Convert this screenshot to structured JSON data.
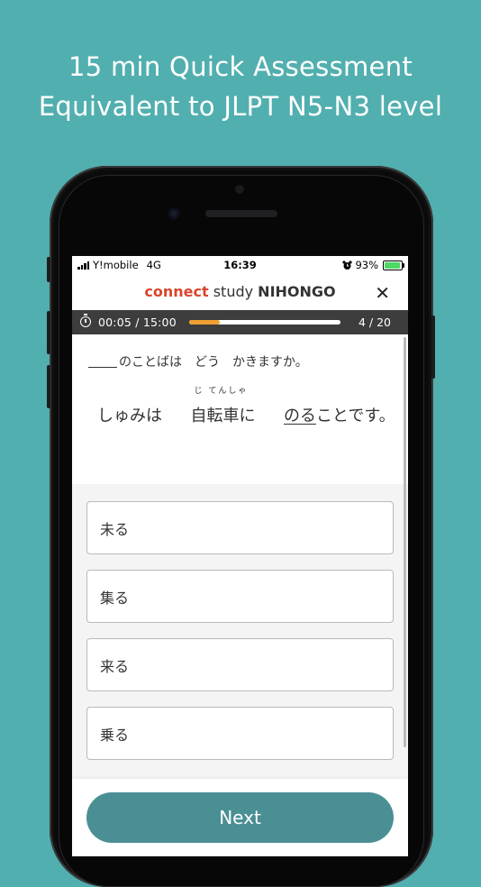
{
  "headline": {
    "line1": "15 min Quick Assessment",
    "line2": "Equivalent to JLPT N5-N3 level"
  },
  "status_bar": {
    "carrier": "Y!mobile",
    "network": "4G",
    "time": "16:39",
    "alarm_icon": "alarm-clock-icon",
    "battery_percent_text": "93%",
    "battery_level": 0.93
  },
  "app_bar": {
    "brand_part1": "connect",
    "brand_part2": "study",
    "brand_part3": "NIHONGO",
    "close_icon": "close-icon",
    "close_glyph": "✕"
  },
  "progress": {
    "elapsed": "00:05",
    "separator": "/",
    "limit": "15:00",
    "fraction_complete": 0.2,
    "current": "4",
    "count_separator": "/",
    "total": "20"
  },
  "question": {
    "prompt": "のことばは　どう　かきますか。",
    "part1": "しゅみは",
    "ruby_text": "じ てんしゃ",
    "ruby_base": "自転車",
    "part2": "に",
    "underlined": "のる",
    "part3": "ことです。"
  },
  "options": [
    "未る",
    "集る",
    "来る",
    "乗る"
  ],
  "next_button": "Next",
  "colors": {
    "background": "#52AFAF",
    "brand_red": "#d9452b",
    "progress_orange": "#f0a033",
    "next_button": "#4a8f94",
    "progress_bar_bg": "#3d3d3d"
  }
}
